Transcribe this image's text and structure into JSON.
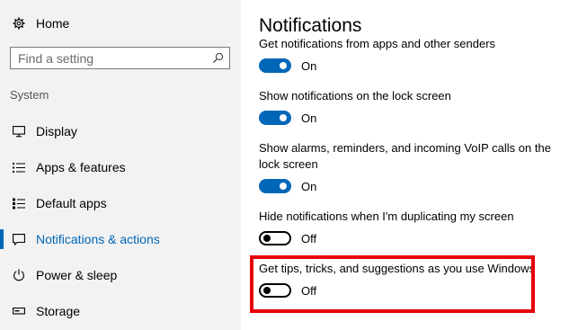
{
  "sidebar": {
    "home_label": "Home",
    "search_placeholder": "Find a setting",
    "section_label": "System",
    "items": [
      {
        "label": "Display",
        "icon": "monitor-icon"
      },
      {
        "label": "Apps & features",
        "icon": "list-icon"
      },
      {
        "label": "Default apps",
        "icon": "default-apps-icon"
      },
      {
        "label": "Notifications & actions",
        "icon": "notification-icon",
        "active": true
      },
      {
        "label": "Power & sleep",
        "icon": "power-icon"
      },
      {
        "label": "Storage",
        "icon": "storage-icon"
      }
    ]
  },
  "main": {
    "title": "Notifications",
    "settings": [
      {
        "label": "Get notifications from apps and other senders",
        "state": "On"
      },
      {
        "label": "Show notifications on the lock screen",
        "state": "On"
      },
      {
        "label": "Show alarms, reminders, and incoming VoIP calls on the lock screen",
        "state": "On"
      },
      {
        "label": "Hide notifications when I'm duplicating my screen",
        "state": "Off"
      },
      {
        "label": "Get tips, tricks, and suggestions as you use Windows",
        "state": "Off",
        "highlighted": true
      }
    ]
  },
  "colors": {
    "accent": "#0067b8",
    "highlight": "#e8000b",
    "sidebar_bg": "#f2f2f2"
  }
}
